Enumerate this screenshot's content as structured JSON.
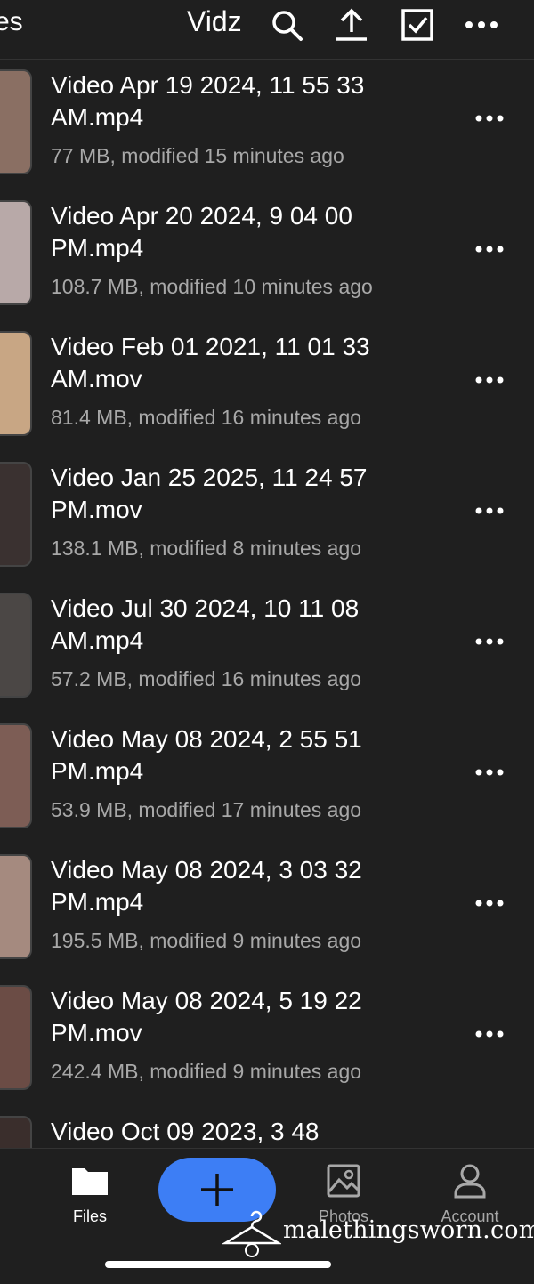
{
  "header": {
    "back_label": "es",
    "title": "Vidz",
    "icons": [
      "search-icon",
      "upload-icon",
      "select-icon",
      "more-icon"
    ]
  },
  "files": [
    {
      "name": "Video Apr 19 2024, 11 55 33 AM.mp4",
      "meta": "77 MB, modified 15 minutes ago",
      "thumb": "#8a6f63"
    },
    {
      "name": "Video Apr 20 2024, 9 04 00 PM.mp4",
      "meta": "108.7 MB, modified 10 minutes ago",
      "thumb": "#b8a9a8"
    },
    {
      "name": "Video Feb 01 2021, 11 01 33 AM.mov",
      "meta": "81.4 MB, modified 16 minutes ago",
      "thumb": "#c8a684"
    },
    {
      "name": "Video Jan 25 2025, 11 24 57 PM.mov",
      "meta": "138.1 MB, modified 8 minutes ago",
      "thumb": "#3a3130"
    },
    {
      "name": "Video Jul 30 2024, 10 11 08 AM.mp4",
      "meta": "57.2 MB, modified 16 minutes ago",
      "thumb": "#4b4745"
    },
    {
      "name": "Video May 08 2024, 2 55 51 PM.mp4",
      "meta": "53.9 MB, modified 17 minutes ago",
      "thumb": "#7d5d55"
    },
    {
      "name": "Video May 08 2024, 3 03 32 PM.mp4",
      "meta": "195.5 MB, modified 9 minutes ago",
      "thumb": "#a58a7f"
    },
    {
      "name": "Video May 08 2024, 5 19 22 PM.mov",
      "meta": "242.4 MB, modified 9 minutes ago",
      "thumb": "#6b4c45"
    },
    {
      "name": "Video Oct 09 2023, 3 48",
      "meta": "",
      "thumb": "#3a2e2c"
    }
  ],
  "tabbar": {
    "files_label": "Files",
    "photos_label": "Photos",
    "account_label": "Account",
    "add_icon": "plus-icon"
  },
  "watermark": "malethingsworn.com",
  "colors": {
    "background": "#1f1f1f",
    "accent": "#3d7ef5",
    "secondary_text": "#a8a8a8"
  }
}
